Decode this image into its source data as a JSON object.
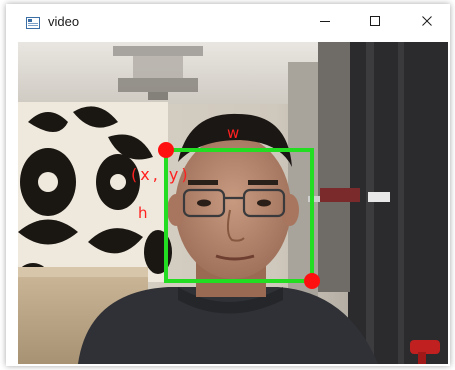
{
  "window": {
    "title": "video",
    "icon": "video-window-icon",
    "controls": {
      "minimize_icon": "minimize-icon",
      "maximize_icon": "maximize-icon",
      "close_icon": "close-icon"
    }
  },
  "video": {
    "annotations": {
      "width_label": "w",
      "height_label": "h",
      "origin_label": "(x, y)"
    },
    "colors": {
      "box": "#22dd22",
      "marker": "#ff1010",
      "label": "#ff2020"
    }
  }
}
